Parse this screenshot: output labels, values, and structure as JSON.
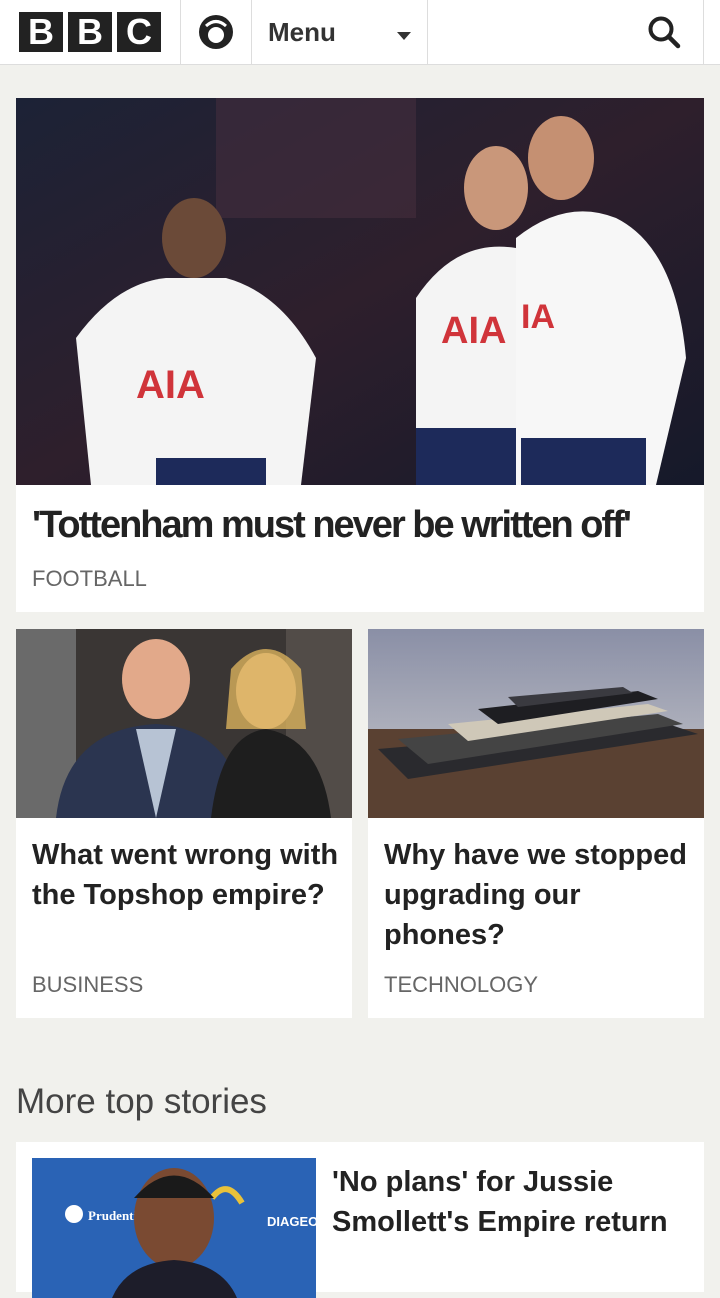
{
  "header": {
    "logo_letters": [
      "B",
      "B",
      "C"
    ],
    "menu_label": "Menu",
    "icons": {
      "account": "account-icon",
      "search": "search-icon",
      "menu_caret": "chevron-down-icon"
    }
  },
  "hero": {
    "title": "'Tottenham must never be written off'",
    "tag": "FOOTBALL",
    "image": "Tottenham players in white AIA shirts"
  },
  "cards": [
    {
      "title": "What went wrong with the Topshop empire?",
      "tag": "BUSINESS"
    },
    {
      "title": "Why have we stopped upgrading our phones?",
      "tag": "TECHNOLOGY"
    }
  ],
  "more": {
    "heading": "More top stories",
    "story": {
      "title": "'No plans' for Jussie Smollett's Empire return"
    },
    "image_logos": [
      "Prudenti",
      "DIAGEO"
    ]
  },
  "colors": {
    "background": "#f1f1ed",
    "text": "#222222",
    "tag": "#666666",
    "logo": "#222222"
  }
}
